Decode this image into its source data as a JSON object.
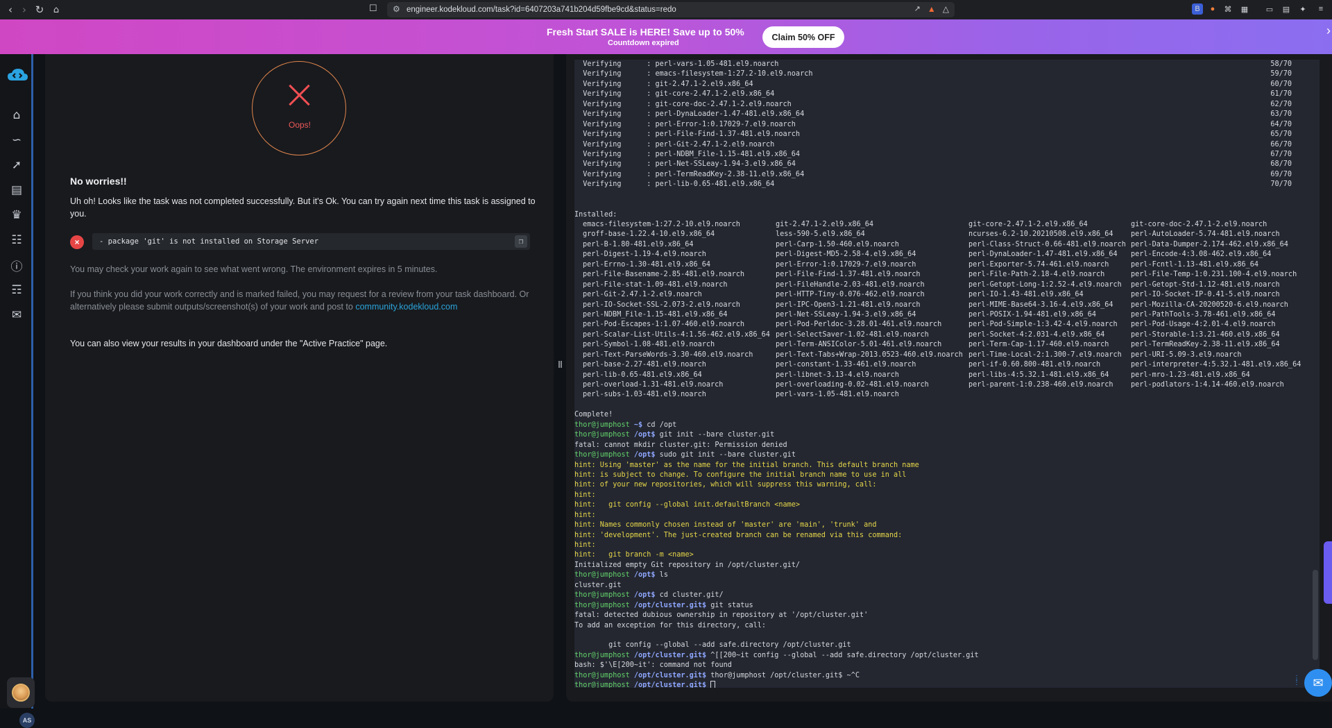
{
  "browser": {
    "url": "engineer.kodekloud.com/task?id=6407203a741b204d59fbe9cd&status=redo"
  },
  "banner": {
    "title": "Fresh Start SALE is HERE!  Save up to 50%",
    "subtitle": "Countdown expired",
    "cta": "Claim 50% OFF"
  },
  "sidebar": {
    "icons": [
      "home-icon",
      "roadmap-icon",
      "skills-icon",
      "courses-icon",
      "leaderboard-icon",
      "playground-icon",
      "info-icon",
      "book-icon",
      "chat-icon"
    ],
    "user_initials": "AS"
  },
  "result": {
    "status_label": "Oops!",
    "heading": "No worries!!",
    "message": "Uh oh! Looks like the task was not completed successfully. But it's Ok. You can try again next time this task is assigned to you.",
    "error": "- package 'git' is not installed on Storage Server",
    "check_note": "You may check your work again to see what went wrong. The environment expires in 5 minutes.",
    "review_note": "If you think you did your work correctly and is marked failed, you may request for a review from your task dashboard. Or alternatively please submit outputs/screenshot(s) of your work and post to ",
    "community_link": "community.kodekloud.com",
    "dashboard_note": "You can also view your results in your dashboard under the \"Active Practice\" page."
  },
  "terminal": {
    "verify_label": "Verifying",
    "verify_rows": [
      {
        "pkg": "perl-vars-1.05-481.el9.noarch",
        "frac": "58/70"
      },
      {
        "pkg": "emacs-filesystem-1:27.2-10.el9.noarch",
        "frac": "59/70"
      },
      {
        "pkg": "git-2.47.1-2.el9.x86_64",
        "frac": "60/70"
      },
      {
        "pkg": "git-core-2.47.1-2.el9.x86_64",
        "frac": "61/70"
      },
      {
        "pkg": "git-core-doc-2.47.1-2.el9.noarch",
        "frac": "62/70"
      },
      {
        "pkg": "perl-DynaLoader-1.47-481.el9.x86_64",
        "frac": "63/70"
      },
      {
        "pkg": "perl-Error-1:0.17029-7.el9.noarch",
        "frac": "64/70"
      },
      {
        "pkg": "perl-File-Find-1.37-481.el9.noarch",
        "frac": "65/70"
      },
      {
        "pkg": "perl-Git-2.47.1-2.el9.noarch",
        "frac": "66/70"
      },
      {
        "pkg": "perl-NDBM_File-1.15-481.el9.x86_64",
        "frac": "67/70"
      },
      {
        "pkg": "perl-Net-SSLeay-1.94-3.el9.x86_64",
        "frac": "68/70"
      },
      {
        "pkg": "perl-TermReadKey-2.38-11.el9.x86_64",
        "frac": "69/70"
      },
      {
        "pkg": "perl-lib-0.65-481.el9.x86_64",
        "frac": "70/70"
      }
    ],
    "installed_label": "Installed:",
    "installed": [
      [
        "emacs-filesystem-1:27.2-10.el9.noarch",
        "git-2.47.1-2.el9.x86_64",
        "git-core-2.47.1-2.el9.x86_64",
        "git-core-doc-2.47.1-2.el9.noarch"
      ],
      [
        "groff-base-1.22.4-10.el9.x86_64",
        "less-590-5.el9.x86_64",
        "ncurses-6.2-10.20210508.el9.x86_64",
        "perl-AutoLoader-5.74-481.el9.noarch"
      ],
      [
        "perl-B-1.80-481.el9.x86_64",
        "perl-Carp-1.50-460.el9.noarch",
        "perl-Class-Struct-0.66-481.el9.noarch",
        "perl-Data-Dumper-2.174-462.el9.x86_64"
      ],
      [
        "perl-Digest-1.19-4.el9.noarch",
        "perl-Digest-MD5-2.58-4.el9.x86_64",
        "perl-DynaLoader-1.47-481.el9.x86_64",
        "perl-Encode-4:3.08-462.el9.x86_64"
      ],
      [
        "perl-Errno-1.30-481.el9.x86_64",
        "perl-Error-1:0.17029-7.el9.noarch",
        "perl-Exporter-5.74-461.el9.noarch",
        "perl-Fcntl-1.13-481.el9.x86_64"
      ],
      [
        "perl-File-Basename-2.85-481.el9.noarch",
        "perl-File-Find-1.37-481.el9.noarch",
        "perl-File-Path-2.18-4.el9.noarch",
        "perl-File-Temp-1:0.231.100-4.el9.noarch"
      ],
      [
        "perl-File-stat-1.09-481.el9.noarch",
        "perl-FileHandle-2.03-481.el9.noarch",
        "perl-Getopt-Long-1:2.52-4.el9.noarch",
        "perl-Getopt-Std-1.12-481.el9.noarch"
      ],
      [
        "perl-Git-2.47.1-2.el9.noarch",
        "perl-HTTP-Tiny-0.076-462.el9.noarch",
        "perl-IO-1.43-481.el9.x86_64",
        "perl-IO-Socket-IP-0.41-5.el9.noarch"
      ],
      [
        "perl-IO-Socket-SSL-2.073-2.el9.noarch",
        "perl-IPC-Open3-1.21-481.el9.noarch",
        "perl-MIME-Base64-3.16-4.el9.x86_64",
        "perl-Mozilla-CA-20200520-6.el9.noarch"
      ],
      [
        "perl-NDBM_File-1.15-481.el9.x86_64",
        "perl-Net-SSLeay-1.94-3.el9.x86_64",
        "perl-POSIX-1.94-481.el9.x86_64",
        "perl-PathTools-3.78-461.el9.x86_64"
      ],
      [
        "perl-Pod-Escapes-1:1.07-460.el9.noarch",
        "perl-Pod-Perldoc-3.28.01-461.el9.noarch",
        "perl-Pod-Simple-1:3.42-4.el9.noarch",
        "perl-Pod-Usage-4:2.01-4.el9.noarch"
      ],
      [
        "perl-Scalar-List-Utils-4:1.56-462.el9.x86_64",
        "perl-SelectSaver-1.02-481.el9.noarch",
        "perl-Socket-4:2.031-4.el9.x86_64",
        "perl-Storable-1:3.21-460.el9.x86_64"
      ],
      [
        "perl-Symbol-1.08-481.el9.noarch",
        "perl-Term-ANSIColor-5.01-461.el9.noarch",
        "perl-Term-Cap-1.17-460.el9.noarch",
        "perl-TermReadKey-2.38-11.el9.x86_64"
      ],
      [
        "perl-Text-ParseWords-3.30-460.el9.noarch",
        "perl-Text-Tabs+Wrap-2013.0523-460.el9.noarch",
        "perl-Time-Local-2:1.300-7.el9.noarch",
        "perl-URI-5.09-3.el9.noarch"
      ],
      [
        "perl-base-2.27-481.el9.noarch",
        "perl-constant-1.33-461.el9.noarch",
        "perl-if-0.60.800-481.el9.noarch",
        "perl-interpreter-4:5.32.1-481.el9.x86_64"
      ],
      [
        "perl-lib-0.65-481.el9.x86_64",
        "perl-libnet-3.13-4.el9.noarch",
        "perl-libs-4:5.32.1-481.el9.x86_64",
        "perl-mro-1.23-481.el9.x86_64"
      ],
      [
        "perl-overload-1.31-481.el9.noarch",
        "perl-overloading-0.02-481.el9.noarch",
        "perl-parent-1:0.238-460.el9.noarch",
        "perl-podlators-1:4.14-460.el9.noarch"
      ],
      [
        "perl-subs-1.03-481.el9.noarch",
        "perl-vars-1.05-481.el9.noarch",
        "",
        ""
      ]
    ],
    "complete": "Complete!",
    "session": [
      {
        "user": "thor@jumphost",
        "path": "~",
        "cmd": " cd /opt"
      },
      {
        "user": "thor@jumphost",
        "path": "/opt",
        "cmd": " git init --bare cluster.git"
      },
      {
        "text": "fatal: cannot mkdir cluster.git: Permission denied"
      },
      {
        "user": "thor@jumphost",
        "path": "/opt",
        "cmd": " sudo git init --bare cluster.git"
      },
      {
        "hint": "hint: Using 'master' as the name for the initial branch. This default branch name"
      },
      {
        "hint": "hint: is subject to change. To configure the initial branch name to use in all"
      },
      {
        "hint": "hint: of your new repositories, which will suppress this warning, call:"
      },
      {
        "hint": "hint:"
      },
      {
        "hint": "hint:   git config --global init.defaultBranch <name>"
      },
      {
        "hint": "hint:"
      },
      {
        "hint": "hint: Names commonly chosen instead of 'master' are 'main', 'trunk' and"
      },
      {
        "hint": "hint: 'development'. The just-created branch can be renamed via this command:"
      },
      {
        "hint": "hint:"
      },
      {
        "hint": "hint:   git branch -m <name>"
      },
      {
        "text": "Initialized empty Git repository in /opt/cluster.git/"
      },
      {
        "user": "thor@jumphost",
        "path": "/opt",
        "cmd": " ls"
      },
      {
        "text": "cluster.git"
      },
      {
        "user": "thor@jumphost",
        "path": "/opt",
        "cmd": " cd cluster.git/"
      },
      {
        "user": "thor@jumphost",
        "path": "/opt/cluster.git",
        "cmd": " git status"
      },
      {
        "text": "fatal: detected dubious ownership in repository at '/opt/cluster.git'"
      },
      {
        "text": "To add an exception for this directory, call:"
      },
      {
        "text": ""
      },
      {
        "text": "        git config --global --add safe.directory /opt/cluster.git"
      },
      {
        "user": "thor@jumphost",
        "path": "/opt/cluster.git",
        "cmd": " ^[[200~it config --global --add safe.directory /opt/cluster.git"
      },
      {
        "text": "bash: $'\\E[200~it': command not found"
      },
      {
        "user": "thor@jumphost",
        "path": "/opt/cluster.git",
        "cmd": " thor@jumphost /opt/cluster.git$ ~^C"
      },
      {
        "user": "thor@jumphost",
        "path": "/opt/cluster.git",
        "cmd": " ",
        "cursor": true
      }
    ]
  }
}
